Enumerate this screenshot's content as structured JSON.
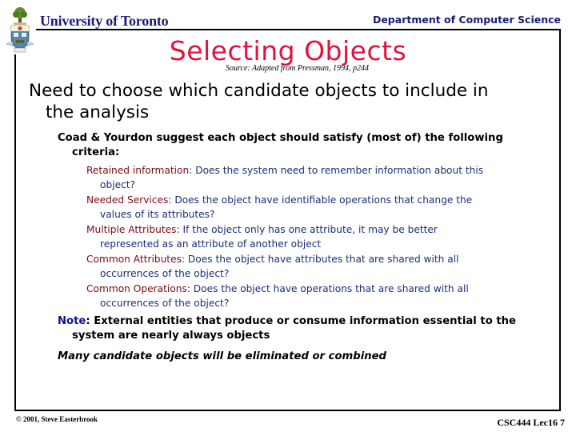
{
  "header": {
    "university": "University of Toronto",
    "department": "Department of Computer Science",
    "logo_icon": "university-crest-icon"
  },
  "slide": {
    "title": "Selecting Objects",
    "source": "Source: Adapted from Pressman, 1994, p244",
    "main_point": {
      "line1": "Need to choose which candidate objects to include in",
      "line2": "the analysis"
    },
    "sub_point": {
      "line1": "Coad & Yourdon suggest each object should satisfy (most of) the following",
      "line2": "criteria:"
    },
    "criteria": [
      {
        "key": "Retained information",
        "sep": ": ",
        "line1": "Does the system need to remember information about this",
        "line2": "object?"
      },
      {
        "key": "Needed Services",
        "sep": ": ",
        "line1": "Does the object have identifiable operations that change the",
        "line2": "values of its attributes?"
      },
      {
        "key": "Multiple Attributes",
        "sep": ": ",
        "line1": "If the object only has one attribute, it may be better",
        "line2": "represented as an attribute of another object"
      },
      {
        "key": "Common Attributes",
        "sep": ": ",
        "line1": "Does the object have attributes that are shared with all",
        "line2": "occurrences of the object?"
      },
      {
        "key": "Common Operations",
        "sep": ": ",
        "line1": "Does the object have operations that are shared with all",
        "line2": "occurrences of the object?"
      }
    ],
    "note": {
      "key": "Note",
      "sep": ": ",
      "line1": "External entities that produce or consume information essential to the",
      "line2": "system are nearly always objects"
    },
    "final_point": "Many candidate objects will be eliminated or combined"
  },
  "footer": {
    "copyright": "© 2001, Steve Easterbrook",
    "slide_id": "CSC444 Lec16 7"
  }
}
